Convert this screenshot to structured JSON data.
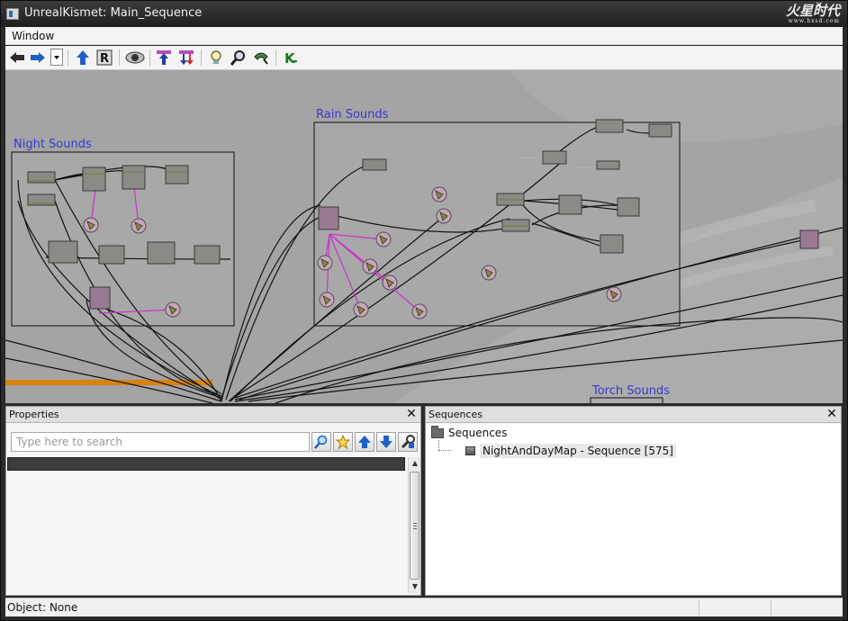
{
  "window": {
    "title": "UnrealKismet: Main_Sequence",
    "watermark": "火星时代",
    "watermark_sub": "www.hxsd.com"
  },
  "menu": {
    "items": [
      "Window"
    ]
  },
  "toolbar": {
    "buttons": [
      "back-arrow-icon",
      "forward-arrow-icon",
      "history-dropdown-icon",
      "parent-sequence-icon",
      "rename-icon",
      "hide-unused-icon",
      "search-up-icon",
      "search-down-icon",
      "lightbulb-icon",
      "zoom-icon",
      "magnet-icon",
      "kismet-k-icon"
    ]
  },
  "canvas": {
    "comment_boxes": [
      {
        "label": "Night Sounds"
      },
      {
        "label": "Rain Sounds"
      },
      {
        "label": "Torch Sounds"
      }
    ],
    "wire_color": "#000000",
    "link_color": "#cc33cc",
    "orange_bar_color": "#d9820e",
    "label_color": "#3a3acc"
  },
  "properties": {
    "title": "Properties",
    "search_placeholder": "Type here to search",
    "search_value": "",
    "buttons": [
      "find-icon",
      "favorite-star-icon",
      "move-up-icon",
      "move-down-icon",
      "settings-wrench-icon"
    ]
  },
  "sequences": {
    "title": "Sequences",
    "root_label": "Sequences",
    "child_label": "NightAndDayMap - Sequence [575]"
  },
  "status": {
    "text": "Object: None"
  }
}
